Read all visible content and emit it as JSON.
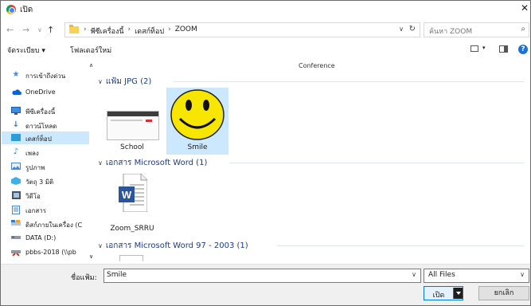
{
  "window": {
    "title": "เปิด"
  },
  "address": {
    "crumbs": [
      "พีซีเครื่องนี้",
      "เดสก์ท็อป",
      "ZOOM"
    ],
    "search_placeholder": "ค้นหา ZOOM"
  },
  "toolbar": {
    "organize_label": "จัดระเบียบ ▾",
    "new_folder_label": "โฟลเดอร์ใหม่"
  },
  "nav": {
    "items": [
      {
        "label": "การเข้าถึงด่วน",
        "icon": "star-icon"
      },
      {
        "label": "OneDrive",
        "icon": "cloud-icon"
      },
      {
        "label": "พีซีเครื่องนี้",
        "icon": "pc-icon"
      },
      {
        "label": "ดาวน์โหลด",
        "icon": "download-icon"
      },
      {
        "label": "เดสก์ท็อป",
        "icon": "desktop-icon",
        "selected": true
      },
      {
        "label": "เพลง",
        "icon": "music-icon"
      },
      {
        "label": "รูปภาพ",
        "icon": "pictures-icon"
      },
      {
        "label": "วัตถุ 3 มิติ",
        "icon": "3d-objects-icon"
      },
      {
        "label": "วิดีโอ",
        "icon": "video-icon"
      },
      {
        "label": "เอกสาร",
        "icon": "documents-icon"
      },
      {
        "label": "ดิสก์ภายในเครื่อง (C",
        "icon": "drive-icon"
      },
      {
        "label": "DATA (D:)",
        "icon": "drive-icon"
      },
      {
        "label": "pbbs-2018 (\\\\pb",
        "icon": "network-drive-icon"
      }
    ]
  },
  "content": {
    "cut_off_labels": [
      "Conference"
    ],
    "groups": [
      {
        "header": "แฟ้ม JPG (2)",
        "items": [
          {
            "label": "School"
          },
          {
            "label": "Smile",
            "selected": true
          }
        ]
      },
      {
        "header": "เอกสาร Microsoft Word (1)",
        "items": [
          {
            "label": "Zoom_SRRU"
          }
        ]
      },
      {
        "header": "เอกสาร Microsoft Word 97 - 2003 (1)",
        "items": []
      }
    ]
  },
  "bottom": {
    "filename_label": "ชื่อแฟ้ม:",
    "filename_value": "Smile",
    "filetype_value": "All Files",
    "open_label": "เปิด",
    "cancel_label": "ยกเลิก"
  },
  "colors": {
    "selection": "#cce8ff",
    "accent": "#0078d7",
    "smiley_yellow": "#f7e600"
  }
}
